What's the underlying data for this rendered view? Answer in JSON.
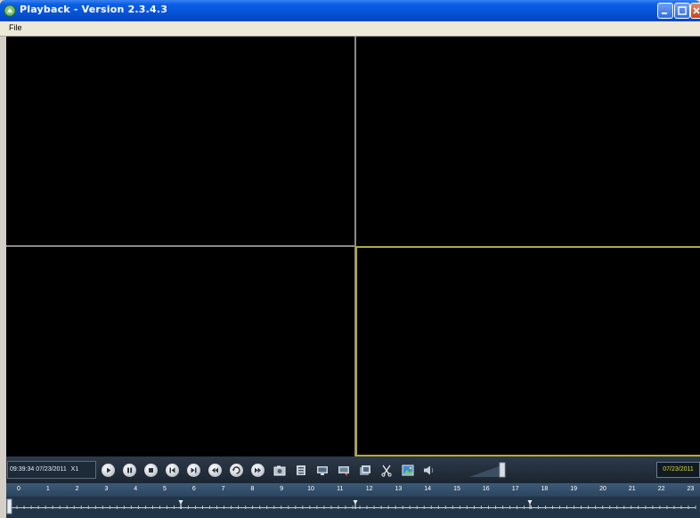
{
  "window": {
    "title": "Playback - Version 2.3.4.3"
  },
  "menu": {
    "items": [
      {
        "label": "File"
      }
    ]
  },
  "colors": {
    "titlebar": "#0553d6",
    "video_background": "#000000",
    "selected_channel_border": "#b7a83a",
    "control_bar": "#1b2531",
    "date_text": "#e9d23a"
  },
  "controls": {
    "current_time": "09:39:34 07/23/2011",
    "speed": "X1",
    "buttons": [
      "play-icon",
      "pause-icon",
      "stop-icon",
      "step-back-icon",
      "step-forward-icon",
      "slow-icon",
      "fast-icon",
      "skip-forward-icon",
      "snapshot-icon",
      "clip-icon",
      "record-icon",
      "backup-icon",
      "export-icon",
      "cut-icon",
      "image-icon",
      "volume-icon"
    ],
    "date": "07/23/2011"
  },
  "timeline": {
    "hours": [
      "0",
      "1",
      "2",
      "3",
      "4",
      "5",
      "6",
      "7",
      "8",
      "9",
      "10",
      "11",
      "12",
      "13",
      "14",
      "15",
      "16",
      "17",
      "18",
      "19",
      "20",
      "21",
      "22",
      "23"
    ]
  }
}
